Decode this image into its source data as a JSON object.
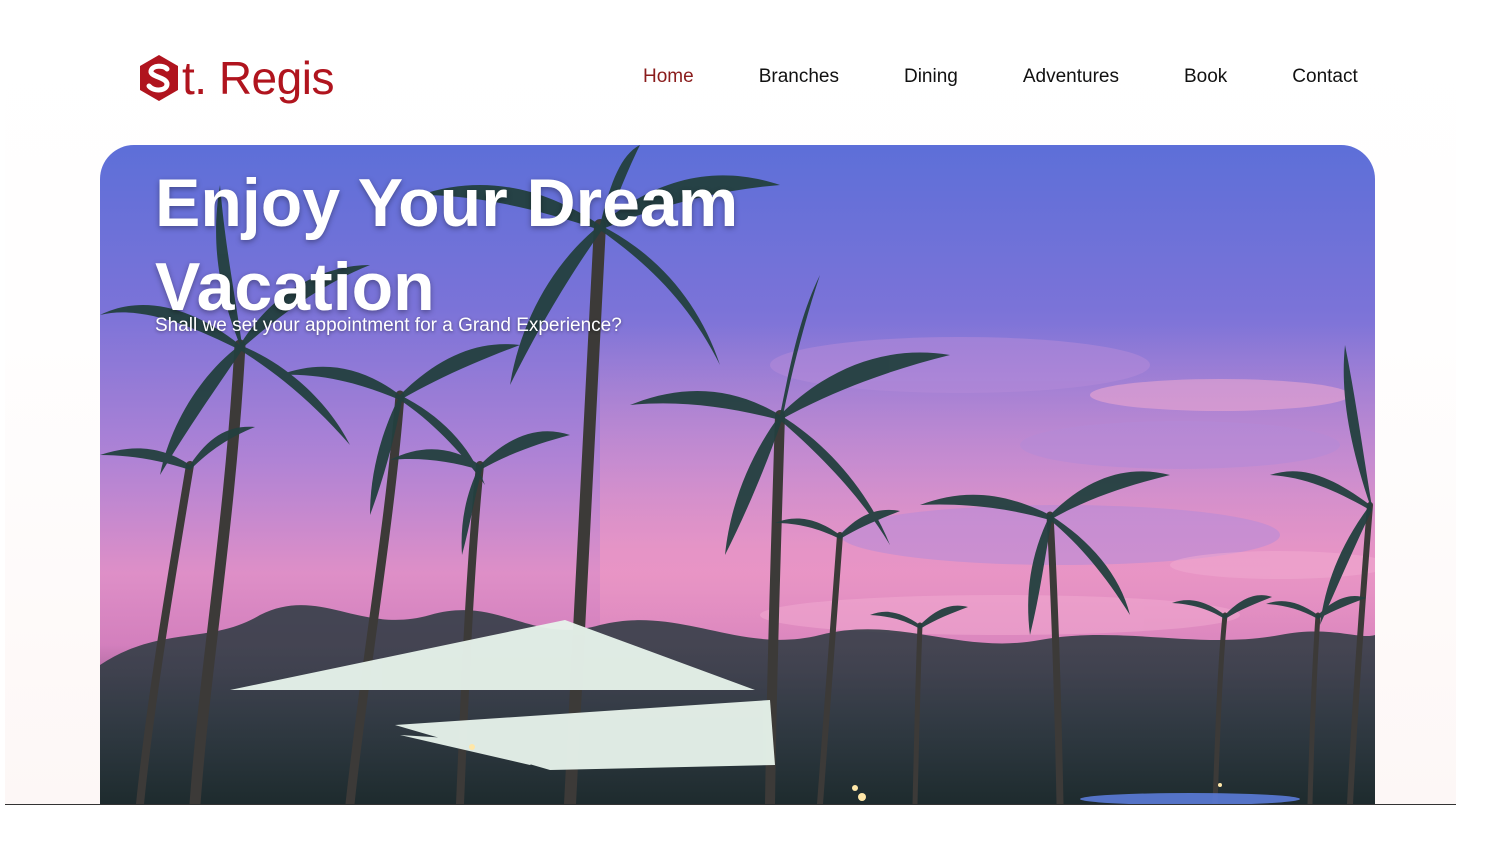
{
  "brand": {
    "name": "St. Regis",
    "logo_mark": "S",
    "logo_text": "t. Regis",
    "color": "#b0141e"
  },
  "nav": {
    "items": [
      {
        "label": "Home",
        "active": true
      },
      {
        "label": "Branches",
        "active": false
      },
      {
        "label": "Dining",
        "active": false
      },
      {
        "label": "Adventures",
        "active": false
      },
      {
        "label": "Book",
        "active": false
      },
      {
        "label": "Contact",
        "active": false
      }
    ],
    "active_color": "#8a1c1c"
  },
  "hero": {
    "title": "Enjoy Your Dream Vacation",
    "subtitle": "Shall we set your appointment for a Grand Experience?",
    "image": "tropical-palm-trees-sunset"
  }
}
